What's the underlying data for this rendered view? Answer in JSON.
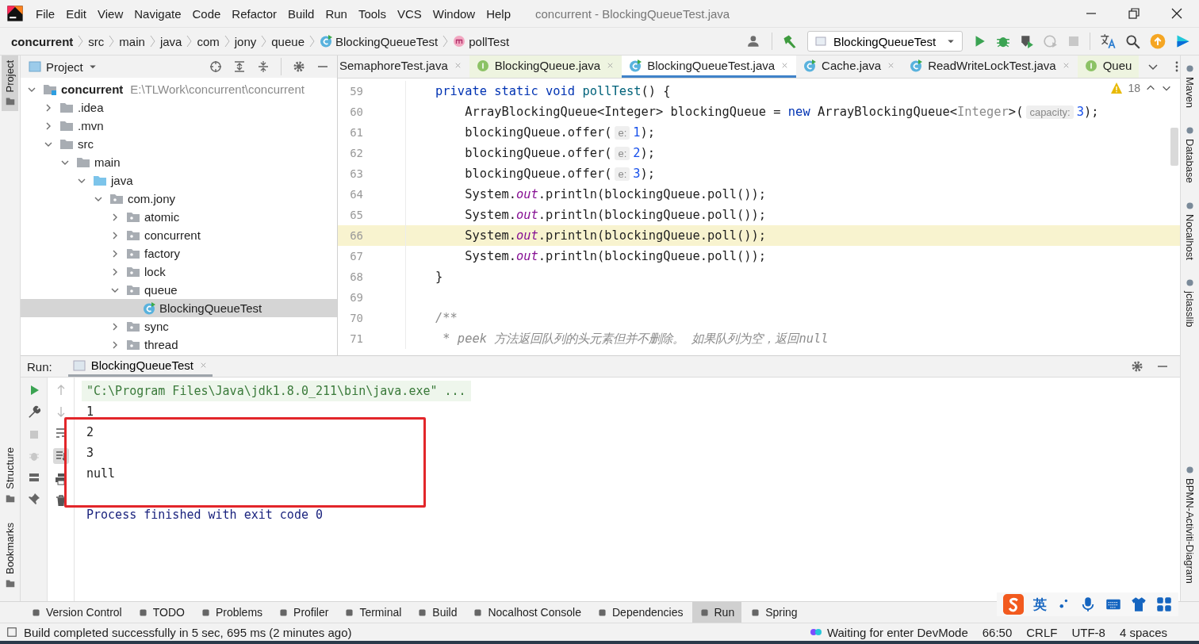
{
  "window": {
    "title": "concurrent - BlockingQueueTest.java"
  },
  "menu": [
    "File",
    "Edit",
    "View",
    "Navigate",
    "Code",
    "Refactor",
    "Build",
    "Run",
    "Tools",
    "VCS",
    "Window",
    "Help"
  ],
  "breadcrumbs": [
    {
      "kind": "project",
      "text": "concurrent"
    },
    {
      "kind": "folder",
      "text": "src"
    },
    {
      "kind": "folder",
      "text": "main"
    },
    {
      "kind": "folder",
      "text": "java"
    },
    {
      "kind": "folder",
      "text": "com"
    },
    {
      "kind": "folder",
      "text": "jony"
    },
    {
      "kind": "folder",
      "text": "queue"
    },
    {
      "kind": "class",
      "text": "BlockingQueueTest"
    },
    {
      "kind": "method",
      "text": "pollTest"
    }
  ],
  "toolbar": {
    "run_config": "BlockingQueueTest"
  },
  "left_stripe": {
    "top": [
      {
        "label": "Project",
        "selected": true
      }
    ],
    "bottom": [
      {
        "label": "Structure",
        "selected": false
      },
      {
        "label": "Bookmarks",
        "selected": false
      }
    ]
  },
  "right_stripe": {
    "top": [
      {
        "label": "Maven"
      },
      {
        "label": "Database"
      },
      {
        "label": "Nocalhost"
      },
      {
        "label": "jclasslib"
      }
    ],
    "bottom": [
      {
        "label": "BPMN-Activiti-Diagram"
      }
    ]
  },
  "project_panel": {
    "title": "Project",
    "tree": [
      {
        "label": "concurrent",
        "path": "E:\\TLWork\\concurrent\\concurrent",
        "kind": "module",
        "expanded": true,
        "selected": false,
        "children": [
          {
            "label": ".idea",
            "kind": "folder",
            "expanded": false,
            "selected": false
          },
          {
            "label": ".mvn",
            "kind": "folder",
            "expanded": false,
            "selected": false
          },
          {
            "label": "src",
            "kind": "folder",
            "expanded": true,
            "selected": false,
            "children": [
              {
                "label": "main",
                "kind": "folder",
                "expanded": true,
                "selected": false,
                "children": [
                  {
                    "label": "java",
                    "kind": "source",
                    "expanded": true,
                    "selected": false,
                    "children": [
                      {
                        "label": "com.jony",
                        "kind": "package",
                        "expanded": true,
                        "selected": false,
                        "children": [
                          {
                            "label": "atomic",
                            "kind": "package",
                            "expanded": false,
                            "selected": false
                          },
                          {
                            "label": "concurrent",
                            "kind": "package",
                            "expanded": false,
                            "selected": false
                          },
                          {
                            "label": "factory",
                            "kind": "package",
                            "expanded": false,
                            "selected": false
                          },
                          {
                            "label": "lock",
                            "kind": "package",
                            "expanded": false,
                            "selected": false
                          },
                          {
                            "label": "queue",
                            "kind": "package",
                            "expanded": true,
                            "selected": false,
                            "children": [
                              {
                                "label": "BlockingQueueTest",
                                "kind": "class",
                                "selected": true
                              }
                            ]
                          },
                          {
                            "label": "sync",
                            "kind": "package",
                            "expanded": false,
                            "selected": false
                          },
                          {
                            "label": "thread",
                            "kind": "package",
                            "expanded": false,
                            "selected": false
                          }
                        ]
                      }
                    ]
                  }
                ]
              }
            ]
          }
        ]
      }
    ]
  },
  "editor": {
    "tabs": [
      {
        "label": "SemaphoreTest.java",
        "kind": "plain",
        "selected": false
      },
      {
        "label": "BlockingQueue.java",
        "kind": "interface",
        "selected": false
      },
      {
        "label": "BlockingQueueTest.java",
        "kind": "class",
        "selected": true
      },
      {
        "label": "Cache.java",
        "kind": "class",
        "selected": false
      },
      {
        "label": "ReadWriteLockTest.java",
        "kind": "class",
        "selected": false
      },
      {
        "label": "Queu",
        "kind": "interface",
        "selected": false
      }
    ],
    "warnings": "18",
    "lines": [
      {
        "number": "59",
        "current": false,
        "tokens": [
          {
            "kind": "keyword",
            "text": "    private static void "
          },
          {
            "kind": "method",
            "text": "pollTest"
          },
          {
            "kind": "plain",
            "text": "() {"
          }
        ]
      },
      {
        "number": "60",
        "current": false,
        "tokens": [
          {
            "kind": "plain",
            "text": "        ArrayBlockingQueue<Integer> blockingQueue = "
          },
          {
            "kind": "keyword",
            "text": "new"
          },
          {
            "kind": "plain",
            "text": " ArrayBlockingQueue<"
          },
          {
            "kind": "muted",
            "text": "Integer"
          },
          {
            "kind": "plain",
            "text": ">("
          },
          {
            "kind": "hint",
            "text": "capacity:"
          },
          {
            "kind": "number",
            "text": "3"
          },
          {
            "kind": "plain",
            "text": ");"
          }
        ]
      },
      {
        "number": "61",
        "current": false,
        "tokens": [
          {
            "kind": "plain",
            "text": "        blockingQueue.offer("
          },
          {
            "kind": "hint",
            "text": "e:"
          },
          {
            "kind": "number",
            "text": "1"
          },
          {
            "kind": "plain",
            "text": ");"
          }
        ]
      },
      {
        "number": "62",
        "current": false,
        "tokens": [
          {
            "kind": "plain",
            "text": "        blockingQueue.offer("
          },
          {
            "kind": "hint",
            "text": "e:"
          },
          {
            "kind": "number",
            "text": "2"
          },
          {
            "kind": "plain",
            "text": ");"
          }
        ]
      },
      {
        "number": "63",
        "current": false,
        "tokens": [
          {
            "kind": "plain",
            "text": "        blockingQueue.offer("
          },
          {
            "kind": "hint",
            "text": "e:"
          },
          {
            "kind": "number",
            "text": "3"
          },
          {
            "kind": "plain",
            "text": ");"
          }
        ]
      },
      {
        "number": "64",
        "current": false,
        "tokens": [
          {
            "kind": "plain",
            "text": "        System."
          },
          {
            "kind": "field",
            "text": "out"
          },
          {
            "kind": "plain",
            "text": ".println(blockingQueue.poll());"
          }
        ]
      },
      {
        "number": "65",
        "current": false,
        "tokens": [
          {
            "kind": "plain",
            "text": "        System."
          },
          {
            "kind": "field",
            "text": "out"
          },
          {
            "kind": "plain",
            "text": ".println(blockingQueue.poll());"
          }
        ]
      },
      {
        "number": "66",
        "current": true,
        "tokens": [
          {
            "kind": "plain",
            "text": "        System."
          },
          {
            "kind": "field",
            "text": "out"
          },
          {
            "kind": "plain",
            "text": ".println(blockingQueue.poll());"
          }
        ]
      },
      {
        "number": "67",
        "current": false,
        "tokens": [
          {
            "kind": "plain",
            "text": "        System."
          },
          {
            "kind": "field",
            "text": "out"
          },
          {
            "kind": "plain",
            "text": ".println(blockingQueue.poll());"
          }
        ]
      },
      {
        "number": "68",
        "current": false,
        "tokens": [
          {
            "kind": "plain",
            "text": "    }"
          }
        ]
      },
      {
        "number": "69",
        "current": false
      },
      {
        "number": "70",
        "current": false,
        "tokens": [
          {
            "kind": "comment",
            "text": "    /**"
          }
        ]
      },
      {
        "number": "71",
        "current": false,
        "tokens": [
          {
            "kind": "comment",
            "text": "     * peek 方法返回队列的头元素但并不删除。 如果队列为空，返回null"
          }
        ]
      }
    ]
  },
  "run_panel": {
    "label": "Run:",
    "tab": "BlockingQueueTest",
    "console": [
      {
        "kind": "command",
        "text": "\"C:\\Program Files\\Java\\jdk1.8.0_211\\bin\\java.exe\" ..."
      },
      {
        "kind": "output",
        "text": "1"
      },
      {
        "kind": "output",
        "text": "2"
      },
      {
        "kind": "output",
        "text": "3"
      },
      {
        "kind": "output",
        "text": "null"
      },
      {
        "kind": "exit",
        "text": "Process finished with exit code 0"
      }
    ]
  },
  "tool_windows": [
    {
      "label": "Version Control",
      "selected": false
    },
    {
      "label": "TODO",
      "selected": false
    },
    {
      "label": "Problems",
      "selected": false
    },
    {
      "label": "Profiler",
      "selected": false
    },
    {
      "label": "Terminal",
      "selected": false
    },
    {
      "label": "Build",
      "selected": false
    },
    {
      "label": "Nocalhost Console",
      "selected": false
    },
    {
      "label": "Dependencies",
      "selected": false
    },
    {
      "label": "Run",
      "selected": true
    },
    {
      "label": "Spring",
      "selected": false
    }
  ],
  "status_bar": {
    "message": "Build completed successfully in 5 sec, 695 ms (2 minutes ago)",
    "items": [
      "Waiting for enter DevMode",
      "66:50",
      "CRLF",
      "UTF-8",
      "4 spaces"
    ]
  },
  "ime_bar": {
    "mode": "英"
  }
}
